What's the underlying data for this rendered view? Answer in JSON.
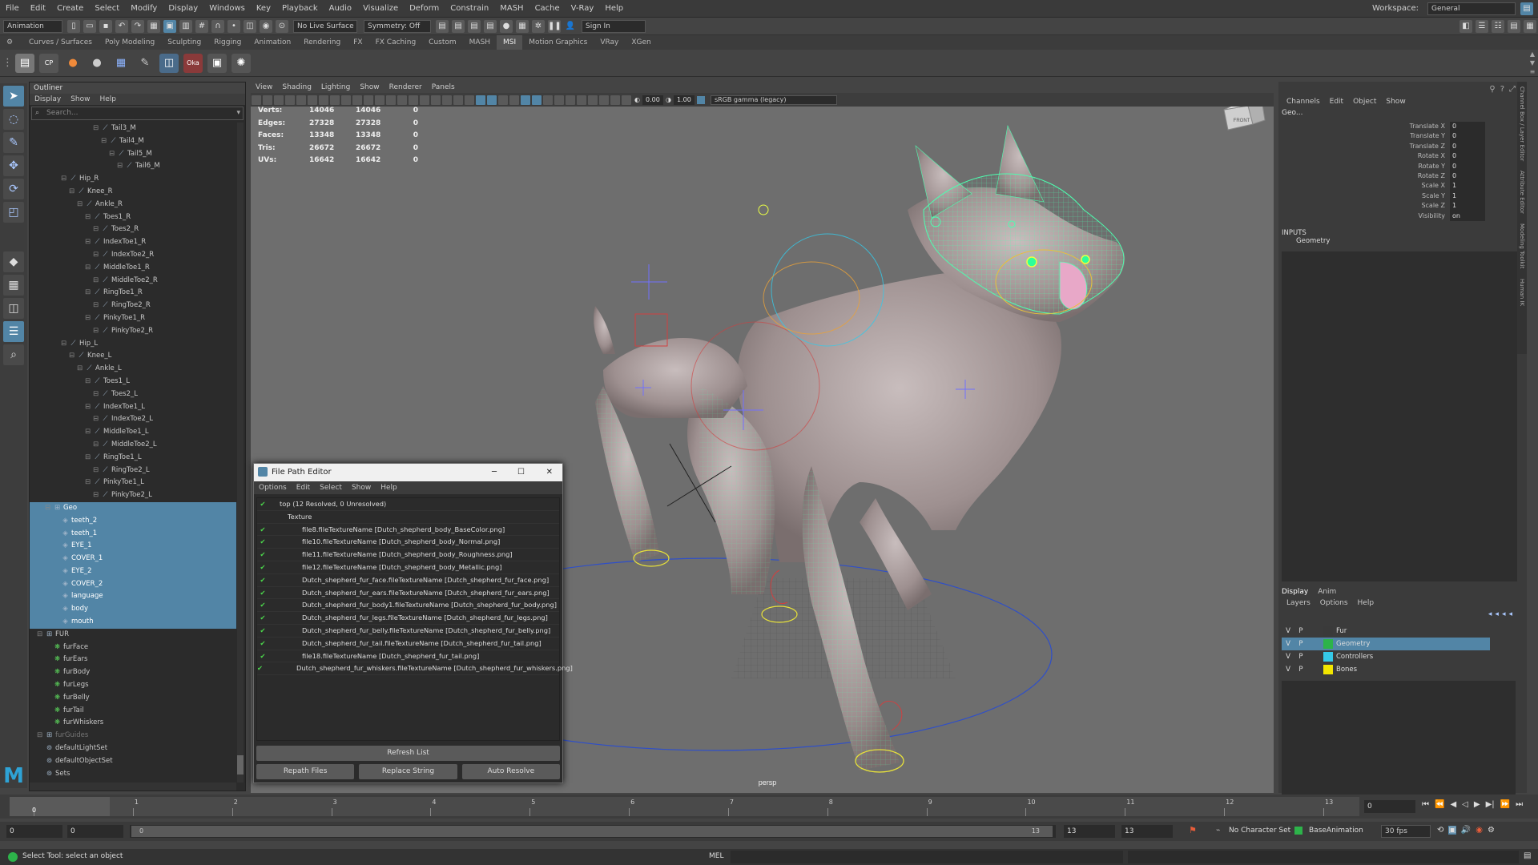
{
  "menubar": {
    "items": [
      "File",
      "Edit",
      "Create",
      "Select",
      "Modify",
      "Display",
      "Windows",
      "Key",
      "Playback",
      "Audio",
      "Visualize",
      "Deform",
      "Constrain",
      "MASH",
      "Cache",
      "V-Ray",
      "Help"
    ],
    "workspace_label": "Workspace:",
    "workspace_value": "General"
  },
  "toolbar": {
    "mode": "Animation",
    "live_surface": "No Live Surface",
    "symmetry": "Symmetry: Off",
    "sign_in": "Sign In"
  },
  "shelf_tabs": [
    "Curves / Surfaces",
    "Poly Modeling",
    "Sculpting",
    "Rigging",
    "Animation",
    "Rendering",
    "FX",
    "FX Caching",
    "Custom",
    "MASH",
    "MSI",
    "Motion Graphics",
    "VRay",
    "XGen"
  ],
  "shelf_active": "MSI",
  "shelf_icon_labels": {
    "cp": "CP",
    "oka": "Oka"
  },
  "outliner": {
    "title": "Outliner",
    "menu": [
      "Display",
      "Show",
      "Help"
    ],
    "search_placeholder": "Search...",
    "rows": [
      {
        "label": "Tail3_M",
        "indent": 7,
        "sel": false,
        "icon": "joint"
      },
      {
        "label": "Tail4_M",
        "indent": 8,
        "sel": false,
        "icon": "joint"
      },
      {
        "label": "Tail5_M",
        "indent": 9,
        "sel": false,
        "icon": "joint"
      },
      {
        "label": "Tail6_M",
        "indent": 10,
        "sel": false,
        "icon": "joint"
      },
      {
        "label": "Hip_R",
        "indent": 3,
        "sel": false,
        "icon": "joint"
      },
      {
        "label": "Knee_R",
        "indent": 4,
        "sel": false,
        "icon": "joint"
      },
      {
        "label": "Ankle_R",
        "indent": 5,
        "sel": false,
        "icon": "joint"
      },
      {
        "label": "Toes1_R",
        "indent": 6,
        "sel": false,
        "icon": "joint"
      },
      {
        "label": "Toes2_R",
        "indent": 7,
        "sel": false,
        "icon": "joint"
      },
      {
        "label": "IndexToe1_R",
        "indent": 6,
        "sel": false,
        "icon": "joint"
      },
      {
        "label": "IndexToe2_R",
        "indent": 7,
        "sel": false,
        "icon": "joint"
      },
      {
        "label": "MiddleToe1_R",
        "indent": 6,
        "sel": false,
        "icon": "joint"
      },
      {
        "label": "MiddleToe2_R",
        "indent": 7,
        "sel": false,
        "icon": "joint"
      },
      {
        "label": "RingToe1_R",
        "indent": 6,
        "sel": false,
        "icon": "joint"
      },
      {
        "label": "RingToe2_R",
        "indent": 7,
        "sel": false,
        "icon": "joint"
      },
      {
        "label": "PinkyToe1_R",
        "indent": 6,
        "sel": false,
        "icon": "joint"
      },
      {
        "label": "PinkyToe2_R",
        "indent": 7,
        "sel": false,
        "icon": "joint"
      },
      {
        "label": "Hip_L",
        "indent": 3,
        "sel": false,
        "icon": "joint"
      },
      {
        "label": "Knee_L",
        "indent": 4,
        "sel": false,
        "icon": "joint"
      },
      {
        "label": "Ankle_L",
        "indent": 5,
        "sel": false,
        "icon": "joint"
      },
      {
        "label": "Toes1_L",
        "indent": 6,
        "sel": false,
        "icon": "joint"
      },
      {
        "label": "Toes2_L",
        "indent": 7,
        "sel": false,
        "icon": "joint"
      },
      {
        "label": "IndexToe1_L",
        "indent": 6,
        "sel": false,
        "icon": "joint"
      },
      {
        "label": "IndexToe2_L",
        "indent": 7,
        "sel": false,
        "icon": "joint"
      },
      {
        "label": "MiddleToe1_L",
        "indent": 6,
        "sel": false,
        "icon": "joint"
      },
      {
        "label": "MiddleToe2_L",
        "indent": 7,
        "sel": false,
        "icon": "joint"
      },
      {
        "label": "RingToe1_L",
        "indent": 6,
        "sel": false,
        "icon": "joint"
      },
      {
        "label": "RingToe2_L",
        "indent": 7,
        "sel": false,
        "icon": "joint"
      },
      {
        "label": "PinkyToe1_L",
        "indent": 6,
        "sel": false,
        "icon": "joint"
      },
      {
        "label": "PinkyToe2_L",
        "indent": 7,
        "sel": false,
        "icon": "joint"
      },
      {
        "label": "Geo",
        "indent": 1,
        "sel": true,
        "icon": "group"
      },
      {
        "label": "teeth_2",
        "indent": 2,
        "sel": true,
        "icon": "mesh"
      },
      {
        "label": "teeth_1",
        "indent": 2,
        "sel": true,
        "icon": "mesh"
      },
      {
        "label": "EYE_1",
        "indent": 2,
        "sel": true,
        "icon": "mesh"
      },
      {
        "label": "COVER_1",
        "indent": 2,
        "sel": true,
        "icon": "mesh"
      },
      {
        "label": "EYE_2",
        "indent": 2,
        "sel": true,
        "icon": "mesh"
      },
      {
        "label": "COVER_2",
        "indent": 2,
        "sel": true,
        "icon": "mesh"
      },
      {
        "label": "language",
        "indent": 2,
        "sel": true,
        "icon": "mesh"
      },
      {
        "label": "body",
        "indent": 2,
        "sel": true,
        "icon": "mesh"
      },
      {
        "label": "mouth",
        "indent": 2,
        "sel": true,
        "icon": "mesh"
      },
      {
        "label": "FUR",
        "indent": 0,
        "sel": false,
        "icon": "group"
      },
      {
        "label": "furFace",
        "indent": 1,
        "sel": false,
        "icon": "fur"
      },
      {
        "label": "furEars",
        "indent": 1,
        "sel": false,
        "icon": "fur"
      },
      {
        "label": "furBody",
        "indent": 1,
        "sel": false,
        "icon": "fur"
      },
      {
        "label": "furLegs",
        "indent": 1,
        "sel": false,
        "icon": "fur"
      },
      {
        "label": "furBelly",
        "indent": 1,
        "sel": false,
        "icon": "fur"
      },
      {
        "label": "furTail",
        "indent": 1,
        "sel": false,
        "icon": "fur"
      },
      {
        "label": "furWhiskers",
        "indent": 1,
        "sel": false,
        "icon": "fur"
      },
      {
        "label": "furGuides",
        "indent": 0,
        "sel": false,
        "icon": "group",
        "dim": true
      },
      {
        "label": "defaultLightSet",
        "indent": 0,
        "sel": false,
        "icon": "set"
      },
      {
        "label": "defaultObjectSet",
        "indent": 0,
        "sel": false,
        "icon": "set"
      },
      {
        "label": "Sets",
        "indent": 0,
        "sel": false,
        "icon": "set"
      }
    ]
  },
  "viewport": {
    "menu": [
      "View",
      "Shading",
      "Lighting",
      "Show",
      "Renderer",
      "Panels"
    ],
    "exposure": "0.00",
    "gamma": "1.00",
    "colorspace": "sRGB gamma (legacy)",
    "camera": "persp",
    "cube_label": "FRONT",
    "hud": [
      [
        "Verts:",
        "14046",
        "14046",
        "0"
      ],
      [
        "Edges:",
        "27328",
        "27328",
        "0"
      ],
      [
        "Faces:",
        "13348",
        "13348",
        "0"
      ],
      [
        "Tris:",
        "26672",
        "26672",
        "0"
      ],
      [
        "UVs:",
        "16642",
        "16642",
        "0"
      ]
    ]
  },
  "file_path_editor": {
    "title": "File Path Editor",
    "menu": [
      "Options",
      "Edit",
      "Select",
      "Show",
      "Help"
    ],
    "root": "top (12 Resolved, 0 Unresolved)",
    "group": "Texture",
    "files": [
      "file8.fileTextureName [Dutch_shepherd_body_BaseColor.png]",
      "file10.fileTextureName [Dutch_shepherd_body_Normal.png]",
      "file11.fileTextureName [Dutch_shepherd_body_Roughness.png]",
      "file12.fileTextureName [Dutch_shepherd_body_Metallic.png]",
      "Dutch_shepherd_fur_face.fileTextureName [Dutch_shepherd_fur_face.png]",
      "Dutch_shepherd_fur_ears.fileTextureName [Dutch_shepherd_fur_ears.png]",
      "Dutch_shepherd_fur_body1.fileTextureName [Dutch_shepherd_fur_body.png]",
      "Dutch_shepherd_fur_legs.fileTextureName [Dutch_shepherd_fur_legs.png]",
      "Dutch_shepherd_fur_belly.fileTextureName [Dutch_shepherd_fur_belly.png]",
      "Dutch_shepherd_fur_tail.fileTextureName [Dutch_shepherd_fur_tail.png]",
      "file18.fileTextureName [Dutch_shepherd_fur_tail.png]",
      "Dutch_shepherd_fur_whiskers.fileTextureName [Dutch_shepherd_fur_whiskers.png]"
    ],
    "refresh": "Refresh List",
    "repath": "Repath Files",
    "replace": "Replace String",
    "auto": "Auto Resolve"
  },
  "channel_box": {
    "menu": [
      "Channels",
      "Edit",
      "Object",
      "Show"
    ],
    "object": "Geo...",
    "attrs": [
      [
        "Translate X",
        "0"
      ],
      [
        "Translate Y",
        "0"
      ],
      [
        "Translate Z",
        "0"
      ],
      [
        "Rotate X",
        "0"
      ],
      [
        "Rotate Y",
        "0"
      ],
      [
        "Rotate Z",
        "0"
      ],
      [
        "Scale X",
        "1"
      ],
      [
        "Scale Y",
        "1"
      ],
      [
        "Scale Z",
        "1"
      ],
      [
        "Visibility",
        "on"
      ]
    ],
    "inputs_label": "INPUTS",
    "inputs_item": "Geometry",
    "side_tabs": [
      "Channel Box / Layer Editor",
      "Attribute Editor",
      "Modeling Toolkit",
      "Human IK"
    ]
  },
  "layers": {
    "tabs": [
      "Display",
      "Anim"
    ],
    "menu": [
      "Layers",
      "Options",
      "Help"
    ],
    "rows": [
      {
        "v": "V",
        "p": "P",
        "name": "Fur",
        "color": "#3a3a3a",
        "sel": false
      },
      {
        "v": "V",
        "p": "P",
        "name": "Geometry",
        "color": "#2db34a",
        "sel": true
      },
      {
        "v": "V",
        "p": "P",
        "name": "Controllers",
        "color": "#35c9e8",
        "sel": false
      },
      {
        "v": "V",
        "p": "P",
        "name": "Bones",
        "color": "#f2e600",
        "sel": false
      }
    ]
  },
  "timeline": {
    "ticks": [
      "0",
      "1",
      "2",
      "3",
      "4",
      "5",
      "6",
      "7",
      "8",
      "9",
      "10",
      "11",
      "12",
      "13"
    ],
    "current_frame": "0",
    "range_start": "0",
    "anim_start": "0",
    "slider_start": "0",
    "slider_end": "13",
    "anim_end": "13",
    "range_end": "13",
    "char_set": "No Character Set",
    "anim_layer": "BaseAnimation",
    "fps": "30 fps"
  },
  "command": {
    "mel": "MEL",
    "help": "Select Tool: select an object"
  },
  "colors": {
    "accent": "#5285a6",
    "selection": "#5285a6",
    "checkmark": "#4cdb4c"
  }
}
